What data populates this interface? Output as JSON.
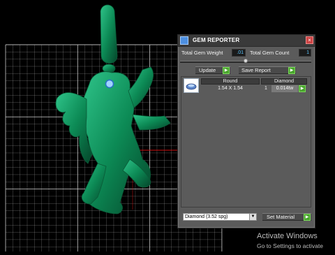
{
  "panel": {
    "title": "GEM REPORTER",
    "total_weight_label": "Total Gem Weight",
    "total_weight_value": ".01",
    "total_count_label": "Total Gem Count",
    "total_count_value": "1",
    "update_label": "Update",
    "save_report_label": "Save Report",
    "gems": [
      {
        "shape": "Round",
        "size": "1.54 X 1.54",
        "material": "Diamond",
        "count": "1",
        "weight": "0.014tw"
      }
    ],
    "material_select_value": "Diamond   (3.52 spg)",
    "set_material_label": "Set Material"
  },
  "watermark": {
    "line1": "Activate Windows",
    "line2": "Go to Settings to activate"
  },
  "colors": {
    "model_green": "#0c7a4c",
    "grid_line": "#c8c8c8",
    "panel_bg": "#5b5b5b",
    "accent_green": "#4aa62e",
    "value_text": "#5ec8ff"
  }
}
